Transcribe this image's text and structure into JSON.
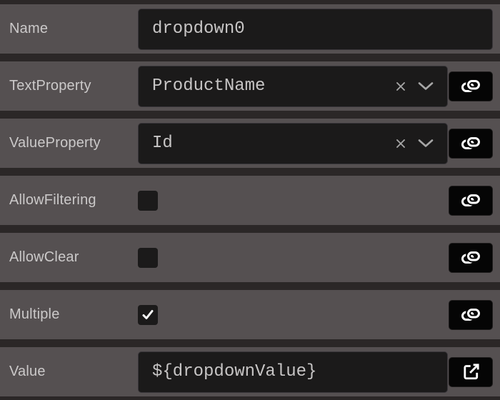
{
  "colors": {
    "background": "#2b2727",
    "row_bg": "#555051",
    "field_bg": "#1b1a1a",
    "field_border": "#39363a",
    "button_bg": "#050505",
    "label_text": "#cbc9c9",
    "field_text": "#c7c5c5",
    "icon_gray": "#a6a6a6",
    "icon_white": "#ffffff"
  },
  "panel": {
    "rows": [
      {
        "id": "name",
        "label": "Name",
        "type": "input",
        "value": "dropdown0",
        "action": null
      },
      {
        "id": "textproperty",
        "label": "TextProperty",
        "type": "dropdown",
        "value": "ProductName",
        "action": "bind",
        "field_icons": [
          "clear-x-icon",
          "chevron-down-icon"
        ]
      },
      {
        "id": "valueproperty",
        "label": "ValueProperty",
        "type": "dropdown",
        "value": "Id",
        "action": "bind",
        "field_icons": [
          "clear-x-icon",
          "chevron-down-icon"
        ]
      },
      {
        "id": "allowfiltering",
        "label": "AllowFiltering",
        "type": "checkbox",
        "checked": false,
        "action": "bind"
      },
      {
        "id": "allowclear",
        "label": "AllowClear",
        "type": "checkbox",
        "checked": false,
        "action": "bind"
      },
      {
        "id": "multiple",
        "label": "Multiple",
        "type": "checkbox",
        "checked": true,
        "action": "bind"
      },
      {
        "id": "value",
        "label": "Value",
        "type": "input",
        "value": "${dropdownValue}",
        "action": "open-external"
      }
    ],
    "action_icons": {
      "bind": "link-chain-icon",
      "open-external": "external-link-icon"
    },
    "checkbox_check_icon": "check-icon"
  }
}
